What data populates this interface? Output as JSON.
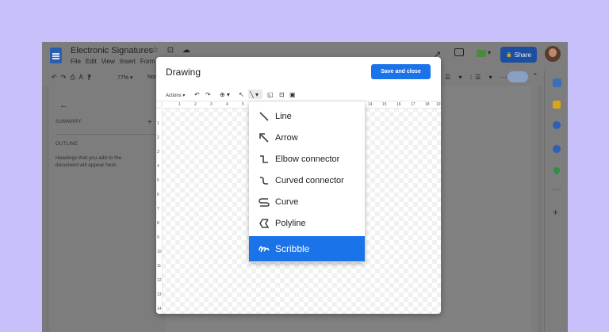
{
  "docs": {
    "title": "Electronic Signatures",
    "title_icons": "☆ ⊡ ☁",
    "menu": [
      "File",
      "Edit",
      "View",
      "Insert",
      "Form"
    ],
    "toolbar": {
      "left_icons": "↶↷⎙Ꭺ⁋",
      "zoom": "77%",
      "zoom_caret": "▾",
      "style": "Nor",
      "right_icons": "☰ ▾ ⁝☰ ▾ ⋯"
    },
    "header_icons": {
      "trend": "↗",
      "meet_caret": "▾",
      "share_icon": "🔒",
      "share_label": "Share",
      "pen_caret": "▾",
      "collapse": "⌃"
    },
    "outline": {
      "back": "←",
      "summary_label": "SUMMARY",
      "summary_add": "+",
      "outline_label": "OUTLINE",
      "outline_hint": "Headings that you add to the document will appear here."
    },
    "side_add": "+"
  },
  "dialog": {
    "title": "Drawing",
    "save_close": "Save and close",
    "toolbar": {
      "actions": "Actions ▾",
      "undo": "↶",
      "redo": "↷",
      "zoom": "⊕ ▾",
      "select": "↖",
      "line": "╲ ▾",
      "shape": "◱",
      "textbox": "⊡",
      "image": "▣"
    },
    "h_ruler_ticks": [
      "1",
      "2",
      "3",
      "4",
      "5",
      "14",
      "15",
      "16",
      "17",
      "18",
      "19"
    ],
    "v_ruler_ticks": [
      "1",
      "2",
      "3",
      "4",
      "5",
      "6",
      "7",
      "8",
      "9",
      "10",
      "11",
      "12",
      "13",
      "14"
    ]
  },
  "line_menu": {
    "items": [
      {
        "label": "Line",
        "icon": "line-icon"
      },
      {
        "label": "Arrow",
        "icon": "arrow-icon"
      },
      {
        "label": "Elbow connector",
        "icon": "elbow-connector-icon"
      },
      {
        "label": "Curved connector",
        "icon": "curved-connector-icon"
      },
      {
        "label": "Curve",
        "icon": "curve-icon"
      },
      {
        "label": "Polyline",
        "icon": "polyline-icon"
      },
      {
        "label": "Scribble",
        "icon": "scribble-icon"
      }
    ],
    "selected": "Scribble",
    "selected_color": "#1a73e8"
  },
  "colors": {
    "background": "#c8c0fb",
    "share_button": "#1d4fa0",
    "save_button": "#1a73e8"
  }
}
